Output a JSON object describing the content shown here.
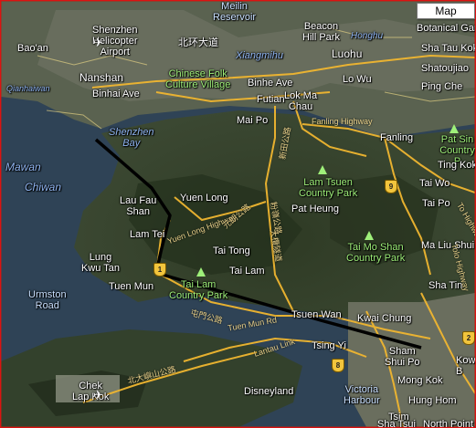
{
  "map_type_button": "Map",
  "places": {
    "meilin_reservoir": "Meilin\nReservoir",
    "beacon_hill_park": "Beacon\nHill Park",
    "botanical_gar": "Botanical Gar",
    "shenzhen_heliport": "Shenzhen\nHelicopter\nAirport",
    "bao_an": "Bao'an",
    "beihuan": "北环大道",
    "hongahu": "Honghu",
    "xiangmihu": "Xiangmihu",
    "luohu": "Luohu",
    "sha_tau_kok": "Sha Tau Kok",
    "shatoujiao": "Shatoujiao",
    "qianhaiwan": "Qianhaiwan",
    "nanshan": "Nanshan",
    "binhai_ave": "Binhai Ave",
    "chinese_folk": "Chinese Folk\nCulture Village",
    "binhe_ave": "Binhe Ave",
    "futian": "Futian",
    "lo_wu": "Lo Wu",
    "lok_ma_chau": "Lok Ma\nChau",
    "ping_che": "Ping Che",
    "shenzhen_bay": "Shenzhen\nBay",
    "mai_po": "Mai Po",
    "fanling_highway": "Fanling Highway",
    "fanling": "Fanling",
    "pat_sin": "Pat Sin\nCountry P",
    "mawan": "Mawan",
    "chiwan": "Chiwan",
    "ting_kok": "Ting Kok",
    "lam_tsuen": "Lam Tsuen\nCountry Park",
    "tai_wo": "Tai Wo",
    "lau_fau_shan": "Lau Fau\nShan",
    "yuen_long": "Yuen Long",
    "pat_heung": "Pat Heung",
    "tai_po": "Tai Po",
    "lam_tei": "Lam Tei",
    "yuen_long_highway": "Yuen Long Highway",
    "tai_mo_shan": "Tai Mo Shan\nCountry Park",
    "ma_liu_shui": "Ma Liu Shui",
    "lung_kwu_tan": "Lung\nKwu Tan",
    "tai_tong": "Tai Tong",
    "tai_lam_cp": "Tai Lam\nCountry Park",
    "tai_lam": "Tai Lam",
    "sha_tin": "Sha Tin",
    "tuen_mun": "Tuen Mun",
    "urmston_road": "Urmston\nRoad",
    "tsuen_wan": "Tsuen Wan",
    "kwai_chung": "Kwai Chung",
    "tuen_mun_rd": "Tuen Mun Rd",
    "tsing_yi": "Tsing Yi",
    "lantau_link": "Lantau Link",
    "sham_shui_po": "Sham\nShui Po",
    "kowloon": "Kow\nB",
    "chek_lap_kok": "Chek\nLap Kok",
    "mong_kok": "Mong Kok",
    "disneyland": "Disneyland",
    "victoria_harbour": "Victoria\nHarbour",
    "hung_hom": "Hung Hom",
    "tsim": "Tsim",
    "sha_tsui": "Sha Tsui",
    "north_point": "North Point",
    "north_lantau_hwy": "北大嶼山公路",
    "to_highway": "To Highway",
    "tolo_highway": "Tolo Highway",
    "chinese_road_1": "元朗公路",
    "chinese_road_2": "新田公路",
    "chinese_road_3": "屯門公路",
    "chinese_road_4": "粉嶺公路",
    "chinese_road_5": "大欖隧道"
  },
  "shields": {
    "route_9": "9",
    "route_8": "8",
    "route_2": "2",
    "route_1": "1"
  },
  "colors": {
    "roads": "#f0b630",
    "route_line": "#000000",
    "frame": "#dd1111"
  },
  "icons": [
    "airplane-icon",
    "tree-icon",
    "route-shield-icon"
  ]
}
